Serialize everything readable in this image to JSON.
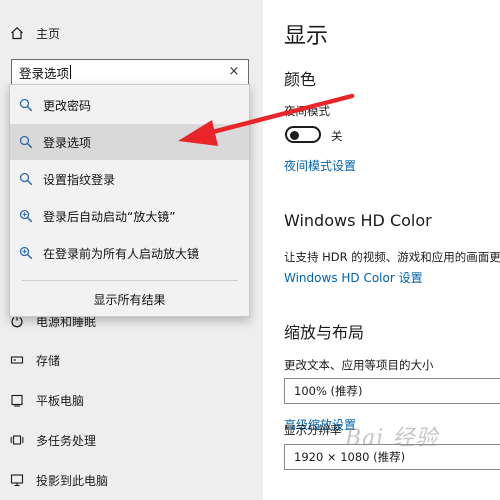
{
  "nav": {
    "home_label": "主页",
    "items": [
      {
        "label": "电源和睡眠",
        "icon": "power-icon"
      },
      {
        "label": "存储",
        "icon": "storage-icon"
      },
      {
        "label": "平板电脑",
        "icon": "tablet-icon"
      },
      {
        "label": "多任务处理",
        "icon": "multitasking-icon"
      },
      {
        "label": "投影到此电脑",
        "icon": "project-icon"
      }
    ]
  },
  "search": {
    "value": "登录选项",
    "clear_glyph": "×"
  },
  "dropdown": {
    "items": [
      {
        "label": "更改密码",
        "icon": "search-icon"
      },
      {
        "label": "登录选项",
        "icon": "search-icon"
      },
      {
        "label": "设置指纹登录",
        "icon": "search-icon"
      },
      {
        "label": "登录后自动启动“放大镜”",
        "icon": "zoom-icon"
      },
      {
        "label": "在登录前为所有人启动放大镜",
        "icon": "zoom-icon"
      }
    ],
    "footer_label": "显示所有结果"
  },
  "main": {
    "title": "显示",
    "color_section": {
      "title": "颜色",
      "night_mode_label": "夜间模式",
      "toggle_state": "关",
      "night_settings_link": "夜间模式设置"
    },
    "hd_section": {
      "title": "Windows HD Color",
      "description": "让支持 HDR 的视频、游戏和应用的画面更",
      "settings_link": "Windows HD Color 设置"
    },
    "scale_section": {
      "title": "缩放与布局",
      "size_label": "更改文本、应用等项目的大小",
      "size_value": "100% (推荐)",
      "advanced_link": "高级缩放设置",
      "resolution_label": "显示分辨率",
      "resolution_value": "1920 × 1080 (推荐)"
    }
  },
  "watermark": "Bai 经验",
  "colors": {
    "arrow": "#e8262a",
    "link": "#0063b1",
    "pane_bg": "#eeeeee"
  }
}
